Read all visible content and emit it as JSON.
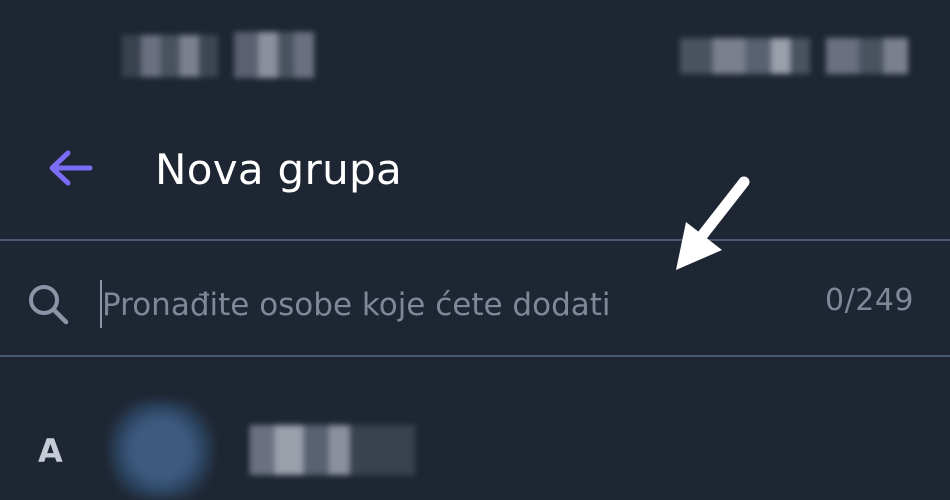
{
  "header": {
    "back_icon": "arrow-left-icon",
    "title": "Nova grupa",
    "accent_color": "#7b6cf6"
  },
  "search": {
    "icon": "search-icon",
    "placeholder": "Pronađite osobe koje ćete dodati",
    "value": "",
    "counter": "0/249"
  },
  "annotation": {
    "icon": "pointer-arrow-icon"
  },
  "contacts": {
    "sections": [
      {
        "letter": "A"
      }
    ]
  }
}
